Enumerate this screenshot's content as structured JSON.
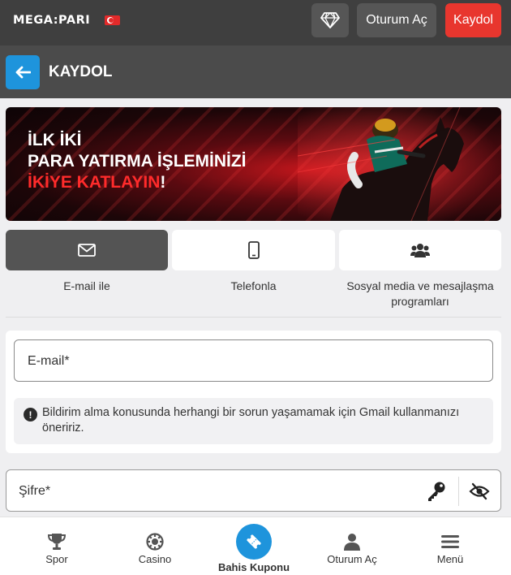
{
  "topbar": {
    "logo_left": "MEGA",
    "logo_sep": ":",
    "logo_right": "PARI",
    "login_label": "Oturum Aç",
    "signup_label": "Kaydol",
    "signup_color": "#e8362e"
  },
  "header": {
    "title": "KAYDOL",
    "back_icon": "arrow-left-icon",
    "accent": "#1e94dc"
  },
  "banner": {
    "line1": "İLK İKİ",
    "line2": "PARA YATIRMA İŞLEMİNİZİ",
    "line3_red": "İKİYE KATLAYIN",
    "line3_end": "!"
  },
  "tabs": [
    {
      "label": "E-mail ile",
      "icon": "envelope-icon",
      "active": true
    },
    {
      "label": "Telefonla",
      "icon": "phone-icon",
      "active": false
    },
    {
      "label": "Sosyal media ve mesajlaşma programları",
      "icon": "users-icon",
      "active": false
    }
  ],
  "form": {
    "email_placeholder": "E-mail*",
    "notice": "Bildirim alma konusunda herhangi bir sorun yaşamamak için Gmail kullanmanızı öneririz.",
    "password_placeholder": "Şifre*"
  },
  "bottom_nav": [
    {
      "label": "Spor",
      "icon": "trophy-icon"
    },
    {
      "label": "Casino",
      "icon": "casino-chip-icon"
    },
    {
      "label": "Bahis Kuponu",
      "icon": "ticket-icon"
    },
    {
      "label": "Oturum Aç",
      "icon": "user-icon"
    },
    {
      "label": "Menü",
      "icon": "hamburger-icon"
    }
  ]
}
